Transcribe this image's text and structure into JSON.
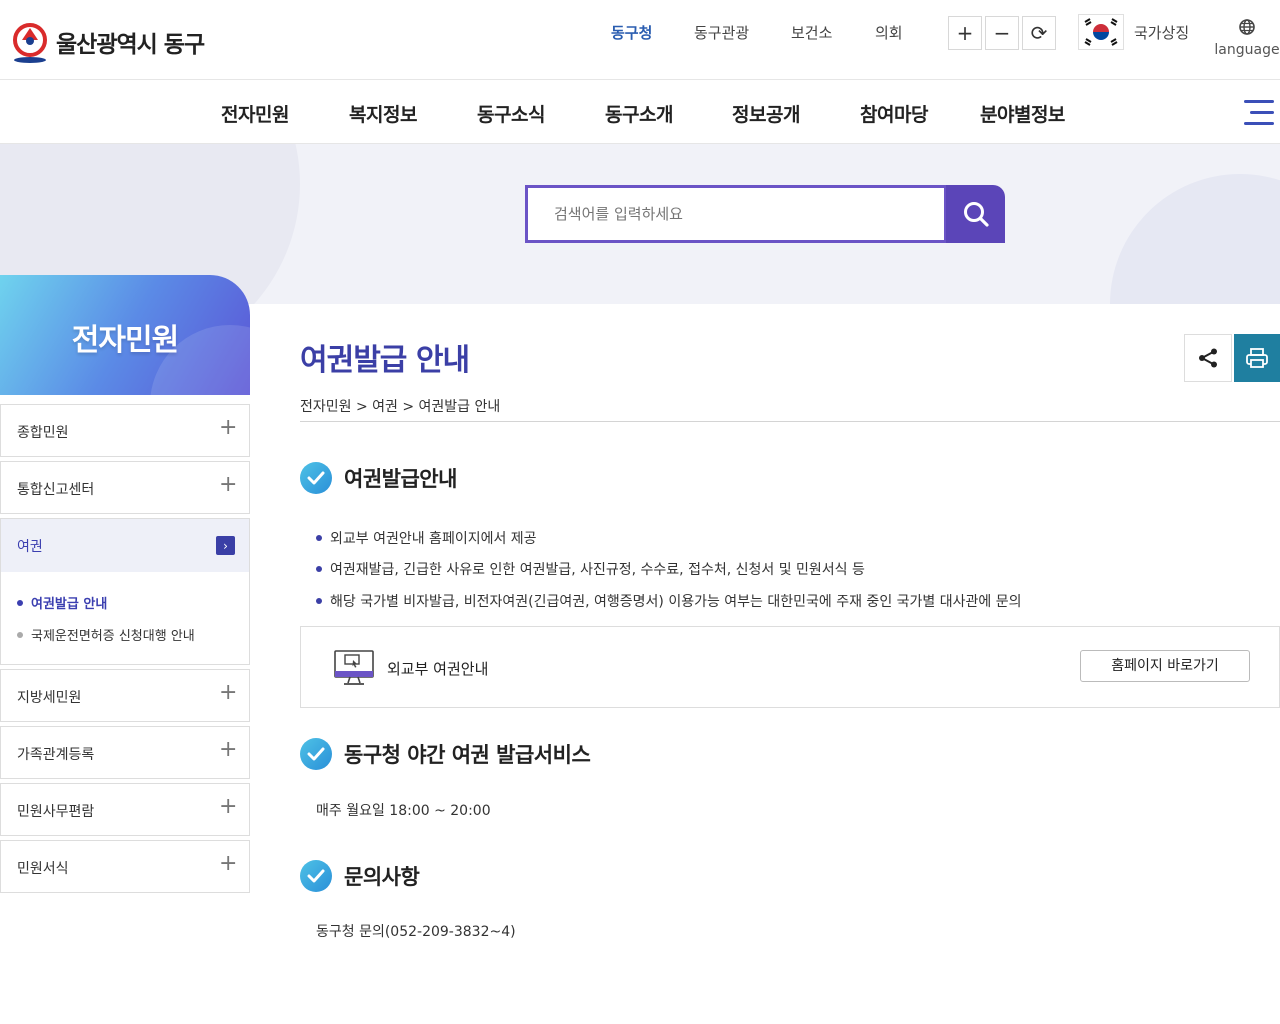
{
  "header": {
    "logo_text": "울산광역시 동구",
    "util_links": [
      "동구청",
      "동구관광",
      "보건소",
      "의회"
    ],
    "zoom_in": "+",
    "zoom_out": "−",
    "reset": "⟳",
    "national_symbol": "국가상징",
    "language": "language"
  },
  "gnb": [
    "전자민원",
    "복지정보",
    "동구소식",
    "동구소개",
    "정보공개",
    "참여마당",
    "분야별정보"
  ],
  "search": {
    "placeholder": "검색어를 입력하세요"
  },
  "sidebar": {
    "title": "전자민원",
    "items": [
      {
        "label": "종합민원"
      },
      {
        "label": "통합신고센터"
      },
      {
        "label": "여권",
        "expanded": true
      },
      {
        "label": "지방세민원"
      },
      {
        "label": "가족관계등록"
      },
      {
        "label": "민원사무편람"
      },
      {
        "label": "민원서식"
      }
    ],
    "sub_items": [
      {
        "label": "여권발급 안내",
        "active": true
      },
      {
        "label": "국제운전면허증 신청대행 안내",
        "active": false
      }
    ]
  },
  "content": {
    "page_title": "여권발급 안내",
    "breadcrumb": "전자민원 > 여권 > 여권발급 안내",
    "sections": [
      {
        "title": "여권발급안내",
        "bullets": [
          "외교부 여권안내 홈페이지에서 제공",
          "여권재발급, 긴급한 사유로 인한 여권발급, 사진규정, 수수료, 접수처, 신청서 및 민원서식 등",
          "해당 국가별 비자발급, 비전자여권(긴급여권, 여행증명서) 이용가능 여부는 대한민국에 주재 중인 국가별 대사관에 문의"
        ],
        "link_box": {
          "label": "외교부 여권안내",
          "button": "홈페이지 바로가기"
        }
      },
      {
        "title": "동구청 야간 여권 발급서비스",
        "text": "매주 월요일 18:00 ~ 20:00"
      },
      {
        "title": "문의사항",
        "text": "동구청 문의(052-209-3832~4)"
      }
    ]
  },
  "colors": {
    "accent": "#3b3fa6",
    "search_border": "#6b54c6",
    "print": "#1f7fa0"
  }
}
